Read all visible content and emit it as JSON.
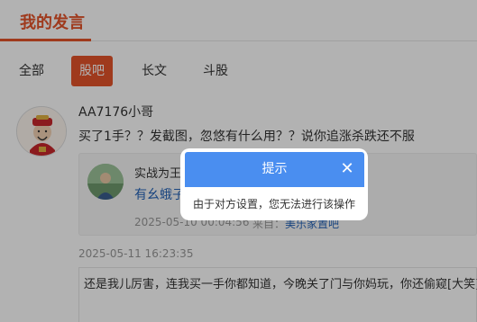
{
  "header": {
    "title": "我的发言"
  },
  "tabs": [
    {
      "label": "全部",
      "active": false
    },
    {
      "label": "股吧",
      "active": true
    },
    {
      "label": "长文",
      "active": false
    },
    {
      "label": "斗股",
      "active": false
    }
  ],
  "post": {
    "username": "AA7176小哥",
    "text": "买了1手？？发截图，忽悠有什么用？？说你追涨杀跌还不服",
    "quote": {
      "author": "实战为王",
      "link_text": "有幺蛾子",
      "date": "2025-05-10 00:04:56",
      "source_label": "来自：",
      "source_link": "美乐家置吧"
    },
    "date": "2025-05-11 16:23:35"
  },
  "reply": {
    "text": "还是我儿厉害，连我买一手你都知道，今晚关了门与你妈玩，你还偷窥[大笑]"
  },
  "dialog": {
    "title": "提示",
    "close_icon": "close-icon",
    "message": "由于对方设置，您无法进行该操作"
  },
  "colors": {
    "accent": "#e4542a",
    "dialog_header": "#4a8ef0",
    "link": "#2463b8",
    "overlay": "rgba(0,0,0,0.3)"
  }
}
